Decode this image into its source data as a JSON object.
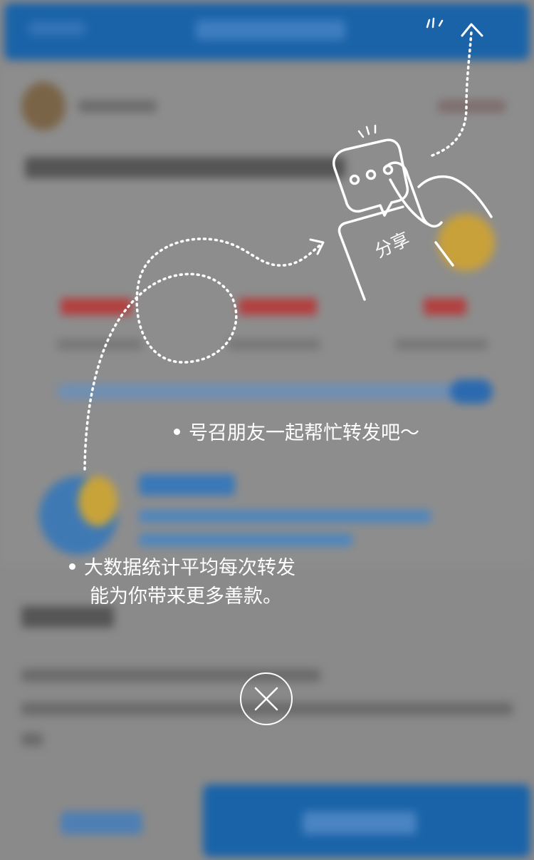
{
  "overlay": {
    "tip_share": "号召朋友一起帮忙转发吧～",
    "tip_stats_line1": "大数据统计平均每次转发",
    "tip_stats_line2": "能为你带来更多善款。",
    "share_label": "分享",
    "close_icon": "close-icon",
    "hand_icon": "hand-tap-share-icon"
  },
  "colors": {
    "overlay_bg": "#8a8a8a",
    "brand_blue": "#1a63a8",
    "text": "#ffffff"
  }
}
